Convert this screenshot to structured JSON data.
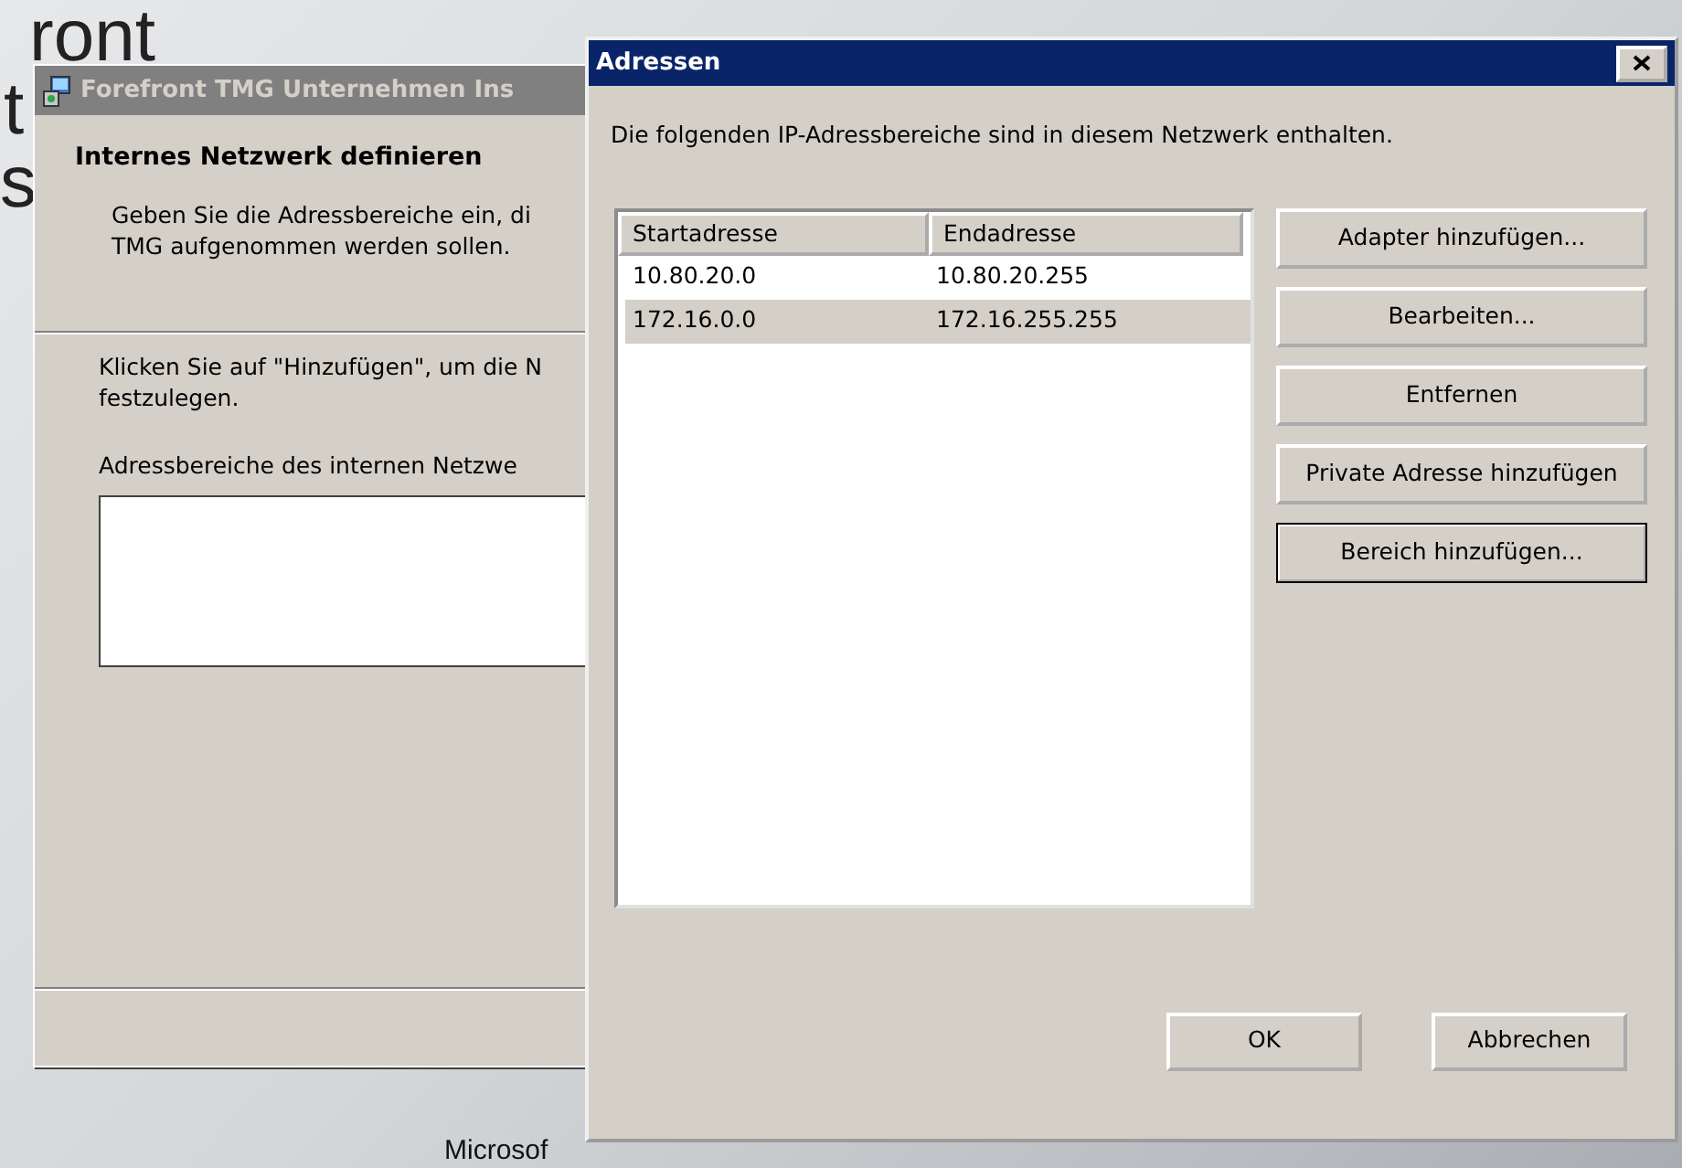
{
  "desktop": {
    "big_texts": [
      "ront",
      "t",
      "s"
    ],
    "footer_text": "Microsof"
  },
  "wizard": {
    "title": "Forefront TMG Unternehmen Ins",
    "heading": "Internes Netzwerk definieren",
    "subtitle_lines": [
      "Geben Sie die Adressbereiche ein, di",
      "TMG aufgenommen werden sollen."
    ],
    "instruction_lines": [
      "Klicken Sie auf \"Hinzufügen\", um die N",
      "festzulegen."
    ],
    "list_label": "Adressbereiche des internen Netzwe"
  },
  "dialog": {
    "title": "Adressen",
    "description": "Die folgenden IP-Adressbereiche sind in diesem Netzwerk enthalten.",
    "columns": [
      "Startadresse",
      "Endadresse"
    ],
    "rows": [
      {
        "cells": [
          "10.80.20.0",
          "10.80.20.255"
        ],
        "selected": false
      },
      {
        "cells": [
          "172.16.0.0",
          "172.16.255.255"
        ],
        "selected": true
      }
    ],
    "side_buttons": [
      {
        "label": "Adapter hinzufügen...",
        "default": false
      },
      {
        "label": "Bearbeiten...",
        "default": false
      },
      {
        "label": "Entfernen",
        "default": false
      },
      {
        "label": "Private Adresse hinzufügen",
        "default": false
      },
      {
        "label": "Bereich hinzufügen...",
        "default": true
      }
    ],
    "footer_buttons": [
      "OK",
      "Abbrechen"
    ]
  }
}
